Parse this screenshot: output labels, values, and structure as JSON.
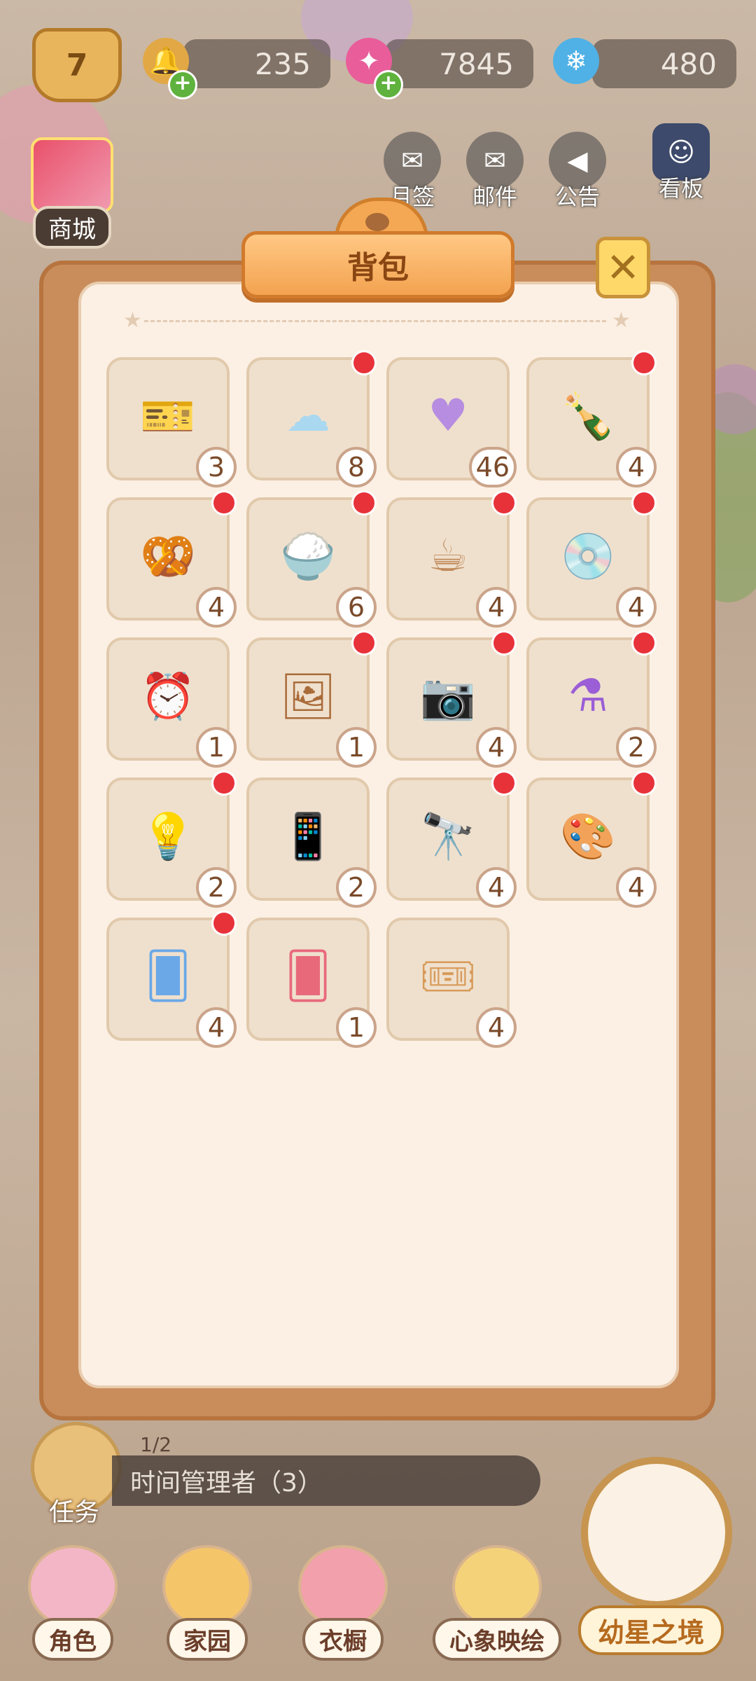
{
  "top_bar": {
    "level": "7",
    "resources": [
      {
        "name": "bell",
        "value": "235"
      },
      {
        "name": "pink-gem",
        "value": "7845"
      },
      {
        "name": "blue-star",
        "value": "480"
      }
    ]
  },
  "top_buttons": {
    "shop": "商城",
    "monthly_checkin": "月签",
    "mail": "邮件",
    "notice": "公告",
    "board": "看板"
  },
  "panel": {
    "title": "背包",
    "close": "✕"
  },
  "items": [
    {
      "icon": "ticket-bell",
      "count": "3",
      "new": false
    },
    {
      "icon": "soap",
      "count": "8",
      "new": true
    },
    {
      "icon": "heart-balloon",
      "count": "46",
      "new": false
    },
    {
      "icon": "cola-bottle",
      "count": "4",
      "new": true
    },
    {
      "icon": "chips-bag",
      "count": "4",
      "new": true
    },
    {
      "icon": "rice-bowl",
      "count": "6",
      "new": true
    },
    {
      "icon": "latte-cup",
      "count": "4",
      "new": true
    },
    {
      "icon": "record-player",
      "count": "4",
      "new": true
    },
    {
      "icon": "digital-clock",
      "count": "1",
      "new": false
    },
    {
      "icon": "painting",
      "count": "1",
      "new": true
    },
    {
      "icon": "instant-camera",
      "count": "4",
      "new": true
    },
    {
      "icon": "potion-bottle",
      "count": "2",
      "new": true
    },
    {
      "icon": "desk-lamp",
      "count": "2",
      "new": true
    },
    {
      "icon": "selfie-stick",
      "count": "2",
      "new": false
    },
    {
      "icon": "telescope",
      "count": "4",
      "new": true
    },
    {
      "icon": "easel",
      "count": "4",
      "new": true
    },
    {
      "icon": "blue-cards",
      "count": "4",
      "new": true
    },
    {
      "icon": "red-cards",
      "count": "1",
      "new": false
    },
    {
      "icon": "gold-ticket",
      "count": "4",
      "new": false
    }
  ],
  "quest": {
    "progress": "1/2",
    "text": "时间管理者（3）",
    "label": "任务"
  },
  "bottom_nav": [
    {
      "label": "角色",
      "icon": "character-icon"
    },
    {
      "label": "家园",
      "icon": "house-icon"
    },
    {
      "label": "衣橱",
      "icon": "hat-icon"
    },
    {
      "label": "心象映绘",
      "icon": "cards-icon"
    }
  ],
  "clock_button": {
    "label": "幼星之境"
  },
  "colors": {
    "accent": "#f3a350",
    "badge_red": "#e8323a",
    "panel": "#fcf0e4"
  }
}
